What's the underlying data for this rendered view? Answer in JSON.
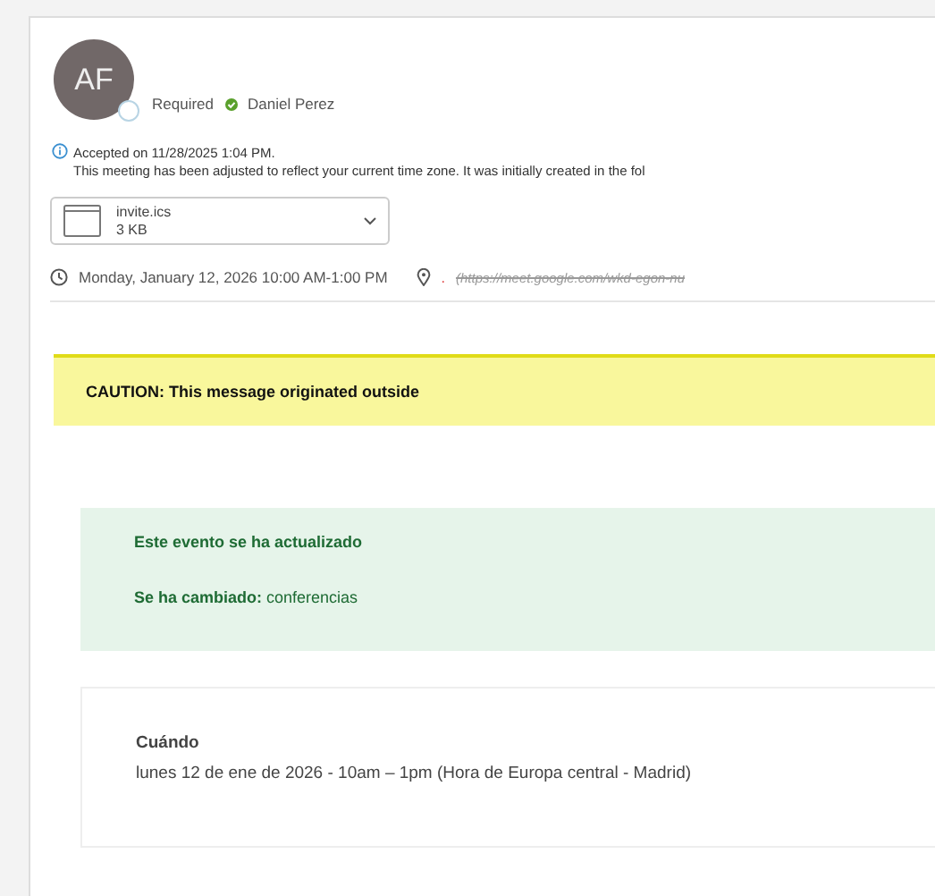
{
  "sender": {
    "initials": "AF",
    "attendance": "Required",
    "attendee": {
      "name": "Daniel Perez",
      "accepted": true
    }
  },
  "notice": {
    "lines": [
      "Accepted on 11/28/2025 1:04 PM.",
      "This meeting has been adjusted to reflect your current time zone. It was initially created in the fol"
    ]
  },
  "attachment": {
    "name": "invite.ics",
    "size": "3 KB"
  },
  "event": {
    "time": "Monday, January 12, 2026 10:00 AM-1:00 PM",
    "location_mark": ".",
    "location": "(https://meet.google.com/wkd-egon-nu"
  },
  "caution": "CAUTION: This message originated outside",
  "update": {
    "title": "Este evento se ha actualizado",
    "change": "**Se ha cambiado:** conferencias"
  },
  "details": {
    "label": "Cuándo",
    "value": "lunes 12 de ene de 2026 - 10am – 1pm (Hora de Europa central - Madrid)"
  }
}
